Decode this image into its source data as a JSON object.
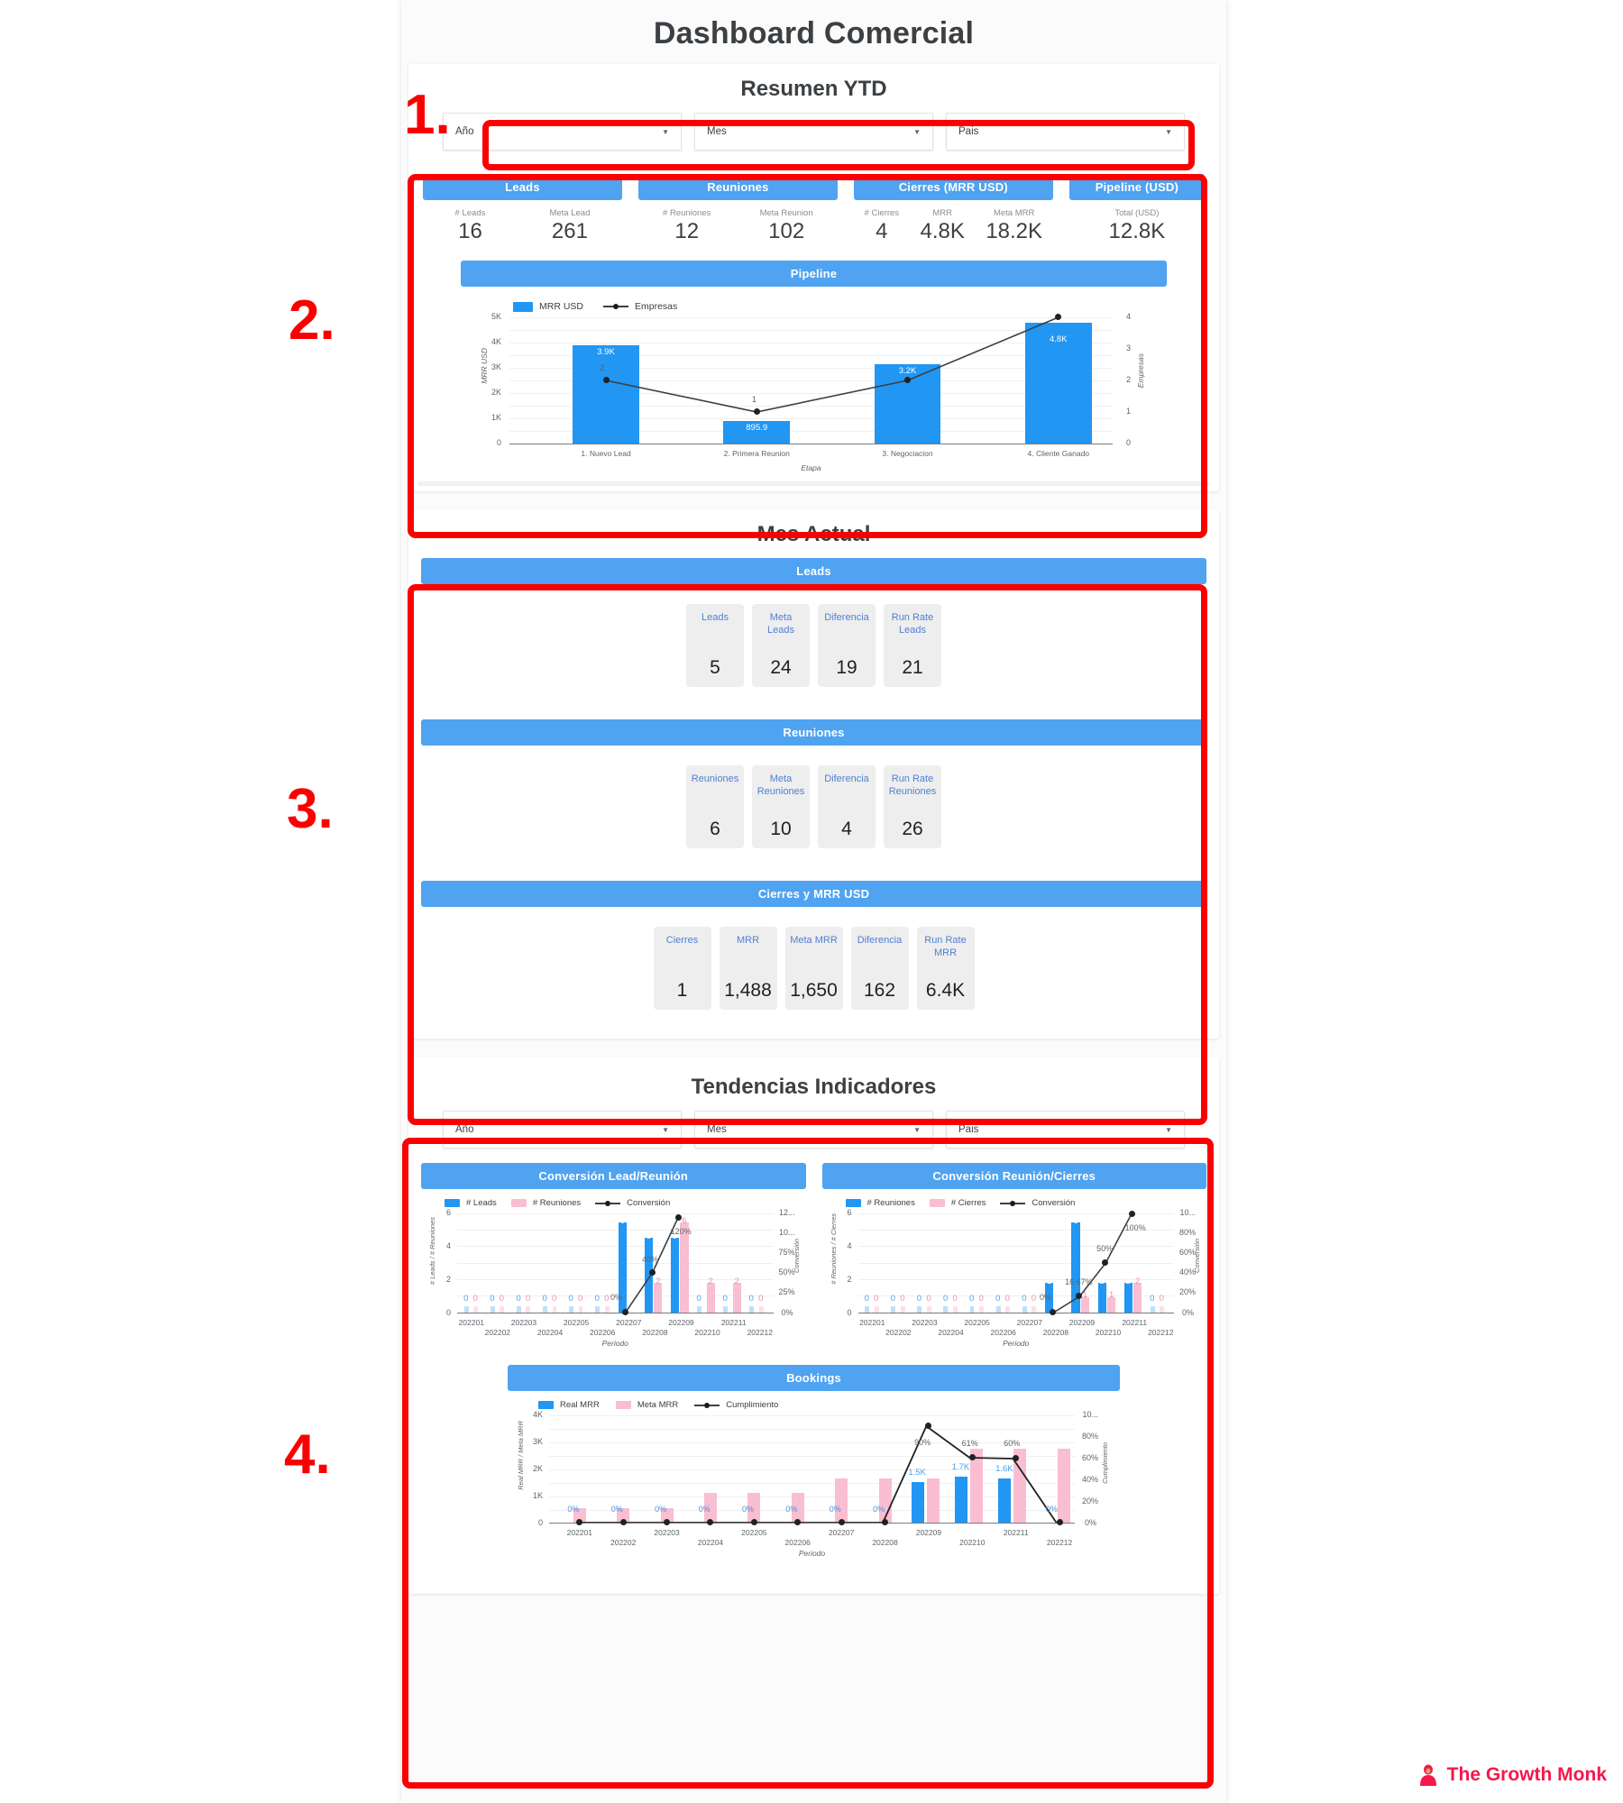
{
  "dashboard": {
    "title": "Dashboard Comercial"
  },
  "annotations": [
    {
      "number": "1."
    },
    {
      "number": "2."
    },
    {
      "number": "3."
    },
    {
      "number": "4."
    }
  ],
  "resumen": {
    "title": "Resumen YTD",
    "filters": [
      {
        "label": "Año",
        "caret": "chevron-down-icon"
      },
      {
        "label": "Mes",
        "caret": "chevron-down-icon"
      },
      {
        "label": "Pais",
        "caret": "chevron-down-icon"
      }
    ],
    "kpi_groups": [
      {
        "title": "Leads",
        "cells": [
          {
            "caption": "# Leads",
            "value": "16"
          },
          {
            "caption": "Meta Lead",
            "value": "261"
          }
        ]
      },
      {
        "title": "Reuniones",
        "cells": [
          {
            "caption": "# Reuniones",
            "value": "12"
          },
          {
            "caption": "Meta Reunion",
            "value": "102"
          }
        ]
      },
      {
        "title": "Cierres (MRR USD)",
        "cells": [
          {
            "caption": "# Cierres",
            "value": "4"
          },
          {
            "caption": "MRR",
            "value": "4.8K"
          },
          {
            "caption": "Meta MRR",
            "value": "18.2K"
          }
        ]
      },
      {
        "title": "Pipeline (USD)",
        "cells": [
          {
            "caption": "Total (USD)",
            "value": "12.8K"
          }
        ]
      }
    ],
    "pipeline_title": "Pipeline"
  },
  "mes_actual": {
    "title": "Mes Actual",
    "blocks": [
      {
        "title": "Leads",
        "cards": [
          {
            "caption": "Leads",
            "value": "5"
          },
          {
            "caption": "Meta Leads",
            "value": "24"
          },
          {
            "caption": "Diferencia",
            "value": "19"
          },
          {
            "caption": "Run Rate Leads",
            "value": "21"
          }
        ]
      },
      {
        "title": "Reuniones",
        "cards": [
          {
            "caption": "Reuniones",
            "value": "6"
          },
          {
            "caption": "Meta Reuniones",
            "value": "10"
          },
          {
            "caption": "Diferencia",
            "value": "4"
          },
          {
            "caption": "Run Rate Reuniones",
            "value": "26"
          }
        ]
      },
      {
        "title": "Cierres y MRR USD",
        "cards": [
          {
            "caption": "Cierres",
            "value": "1"
          },
          {
            "caption": "MRR",
            "value": "1,488"
          },
          {
            "caption": "Meta MRR",
            "value": "1,650"
          },
          {
            "caption": "Diferencia",
            "value": "162"
          },
          {
            "caption": "Run Rate MRR",
            "value": "6.4K"
          }
        ]
      }
    ]
  },
  "tendencias": {
    "title": "Tendencias Indicadores",
    "filters": [
      {
        "label": "Año",
        "caret": "chevron-down-icon"
      },
      {
        "label": "Mes",
        "caret": "chevron-down-icon"
      },
      {
        "label": "Pais",
        "caret": "chevron-down-icon"
      }
    ],
    "chart_titles": {
      "left": "Conversión Lead/Reunión",
      "right": "Conversión Reunión/Cierres",
      "bookings": "Bookings"
    }
  },
  "footer": {
    "brand": "The Growth Monk",
    "icon": "monk-logo-icon"
  },
  "colors": {
    "accent_blue": "#4fa3f0",
    "bar_blue": "#2196f3",
    "bar_pink": "#f9bed1",
    "line_dark": "#202124",
    "annotation_red": "#fa0000",
    "brand_pink": "#f5184c",
    "card_bg": "#eeeeee",
    "card_caption": "#4f7fd4"
  },
  "chart_data": [
    {
      "id": "pipeline",
      "type": "bar",
      "title": "Pipeline",
      "xlabel": "Etapa",
      "ylabel": "MRR USD",
      "y2label": "Empresas",
      "categories": [
        "1. Nuevo Lead",
        "2. Primera Reunion",
        "3. Negociacion",
        "4. Cliente Ganado"
      ],
      "ylim": [
        0,
        5000
      ],
      "yticks": [
        "0",
        "1K",
        "2K",
        "3K",
        "4K",
        "5K"
      ],
      "y2lim": [
        0,
        4
      ],
      "y2ticks": [
        "0",
        "1",
        "2",
        "3",
        "4"
      ],
      "grid": true,
      "legend": [
        "MRR USD",
        "Empresas"
      ],
      "legend_position": "top-left",
      "series": [
        {
          "name": "MRR USD",
          "kind": "bar",
          "color": "#2196f3",
          "values": [
            3900,
            895.9,
            3150,
            4800
          ],
          "labels": [
            "3.9K",
            "895.9",
            "3.2K",
            "4.8K"
          ]
        },
        {
          "name": "Empresas",
          "kind": "line",
          "color": "#202124",
          "values": [
            2,
            1,
            2,
            4
          ],
          "labels": [
            "2",
            "1",
            "",
            ""
          ]
        }
      ]
    },
    {
      "id": "conversion-lead-reunion",
      "type": "bar",
      "title": "Conversión Lead/Reunión",
      "xlabel": "Periodo",
      "ylabel": "# Leads / # Reuniones",
      "y2label": "Conversión",
      "categories": [
        "202201",
        "202202",
        "202203",
        "202204",
        "202205",
        "202206",
        "202207",
        "202208",
        "202209",
        "202210",
        "202211",
        "202212"
      ],
      "ylim": [
        0,
        6
      ],
      "yticks": [
        "0",
        "2",
        "4",
        "6"
      ],
      "y2lim": [
        0,
        125
      ],
      "y2ticks": [
        "0%",
        "25%",
        "50%",
        "75%",
        "10...",
        "12..."
      ],
      "grid": true,
      "legend": [
        "# Leads",
        "# Reuniones",
        "Conversión"
      ],
      "legend_position": "top-left",
      "series": [
        {
          "name": "# Leads",
          "kind": "bar",
          "color": "#2196f3",
          "values": [
            0,
            0,
            0,
            0,
            0,
            0,
            6,
            5,
            5,
            0,
            0,
            0
          ],
          "labels": [
            "0",
            "0",
            "0",
            "0",
            "0",
            "0",
            "6",
            "5",
            "5",
            "0",
            "0",
            "0"
          ]
        },
        {
          "name": "# Reuniones",
          "kind": "bar",
          "color": "#f9bed1",
          "values": [
            0,
            0,
            0,
            0,
            0,
            0,
            0,
            2,
            6,
            2,
            2,
            0
          ],
          "labels": [
            "0",
            "0",
            "0",
            "0",
            "0",
            "0",
            "",
            "2",
            "6",
            "2",
            "2",
            "0"
          ]
        },
        {
          "name": "Conversión",
          "kind": "line",
          "color": "#202124",
          "values": [
            null,
            null,
            null,
            null,
            null,
            null,
            0,
            40,
            120,
            null,
            null,
            null
          ],
          "labels": [
            "",
            "",
            "",
            "",
            "",
            "",
            "0%",
            "40%",
            "120%",
            "",
            "",
            ""
          ]
        }
      ]
    },
    {
      "id": "conversion-reunion-cierres",
      "type": "bar",
      "title": "Conversión Reunión/Cierres",
      "xlabel": "Periodo",
      "ylabel": "# Reuniones / # Cierres",
      "y2label": "Conversión",
      "categories": [
        "202201",
        "202202",
        "202203",
        "202204",
        "202205",
        "202206",
        "202207",
        "202208",
        "202209",
        "202210",
        "202211",
        "202212"
      ],
      "ylim": [
        0,
        6
      ],
      "yticks": [
        "0",
        "2",
        "4",
        "6"
      ],
      "y2lim": [
        0,
        100
      ],
      "y2ticks": [
        "0%",
        "20%",
        "40%",
        "60%",
        "80%",
        "10..."
      ],
      "grid": true,
      "legend": [
        "# Reuniones",
        "# Cierres",
        "Conversión"
      ],
      "legend_position": "top-left",
      "series": [
        {
          "name": "# Reuniones",
          "kind": "bar",
          "color": "#2196f3",
          "values": [
            0,
            0,
            0,
            0,
            0,
            0,
            0,
            2,
            6,
            2,
            2,
            0
          ],
          "labels": [
            "0",
            "0",
            "0",
            "0",
            "0",
            "0",
            "0",
            "2",
            "6",
            "2",
            "2",
            "0"
          ]
        },
        {
          "name": "# Cierres",
          "kind": "bar",
          "color": "#f9bed1",
          "values": [
            0,
            0,
            0,
            0,
            0,
            0,
            0,
            0,
            1,
            1,
            2,
            0
          ],
          "labels": [
            "0",
            "0",
            "0",
            "0",
            "0",
            "0",
            "0",
            "",
            "1",
            "1",
            "2",
            "0"
          ]
        },
        {
          "name": "Conversión",
          "kind": "line",
          "color": "#202124",
          "values": [
            null,
            null,
            null,
            null,
            null,
            null,
            null,
            0,
            16.67,
            50,
            100,
            null
          ],
          "labels": [
            "",
            "",
            "",
            "",
            "",
            "",
            "",
            "0%",
            "16.67%",
            "50%",
            "100%",
            ""
          ]
        }
      ]
    },
    {
      "id": "bookings",
      "type": "bar",
      "title": "Bookings",
      "xlabel": "Periodo",
      "ylabel": "Real MRR / Meta MRR",
      "y2label": "Cumplimiento",
      "categories": [
        "202201",
        "202202",
        "202203",
        "202204",
        "202205",
        "202206",
        "202207",
        "202208",
        "202209",
        "202210",
        "202211",
        "202212"
      ],
      "ylim": [
        0,
        4000
      ],
      "yticks": [
        "0",
        "1K",
        "2K",
        "3K",
        "4K"
      ],
      "y2lim": [
        0,
        100
      ],
      "y2ticks": [
        "0%",
        "20%",
        "40%",
        "60%",
        "80%",
        "10..."
      ],
      "grid": true,
      "legend": [
        "Real MRR",
        "Meta MRR",
        "Cumplimiento"
      ],
      "legend_position": "top-left",
      "series": [
        {
          "name": "Real MRR",
          "kind": "bar",
          "color": "#2196f3",
          "values": [
            0,
            0,
            0,
            0,
            0,
            0,
            0,
            0,
            1500,
            1700,
            1640,
            0
          ],
          "labels": [
            "",
            "",
            "",
            "",
            "",
            "",
            "",
            "",
            "1.5K",
            "1.7K",
            "1.6K",
            ""
          ]
        },
        {
          "name": "Meta MRR",
          "kind": "bar",
          "color": "#f9bed1",
          "values": [
            520,
            520,
            520,
            1090,
            1080,
            1080,
            1640,
            1640,
            1640,
            2750,
            2750,
            2750
          ],
          "labels": [
            "",
            "",
            "",
            "",
            "",
            "",
            "",
            "",
            "",
            "",
            "",
            ""
          ]
        },
        {
          "name": "Cumplimiento",
          "kind": "line",
          "color": "#202124",
          "values": [
            0,
            0,
            0,
            0,
            0,
            0,
            0,
            0,
            90,
            61,
            60,
            0
          ],
          "labels": [
            "0%",
            "0%",
            "0%",
            "0%",
            "0%",
            "0%",
            "0%",
            "0%",
            "90%",
            "61%",
            "60%",
            "0%"
          ]
        }
      ]
    }
  ]
}
